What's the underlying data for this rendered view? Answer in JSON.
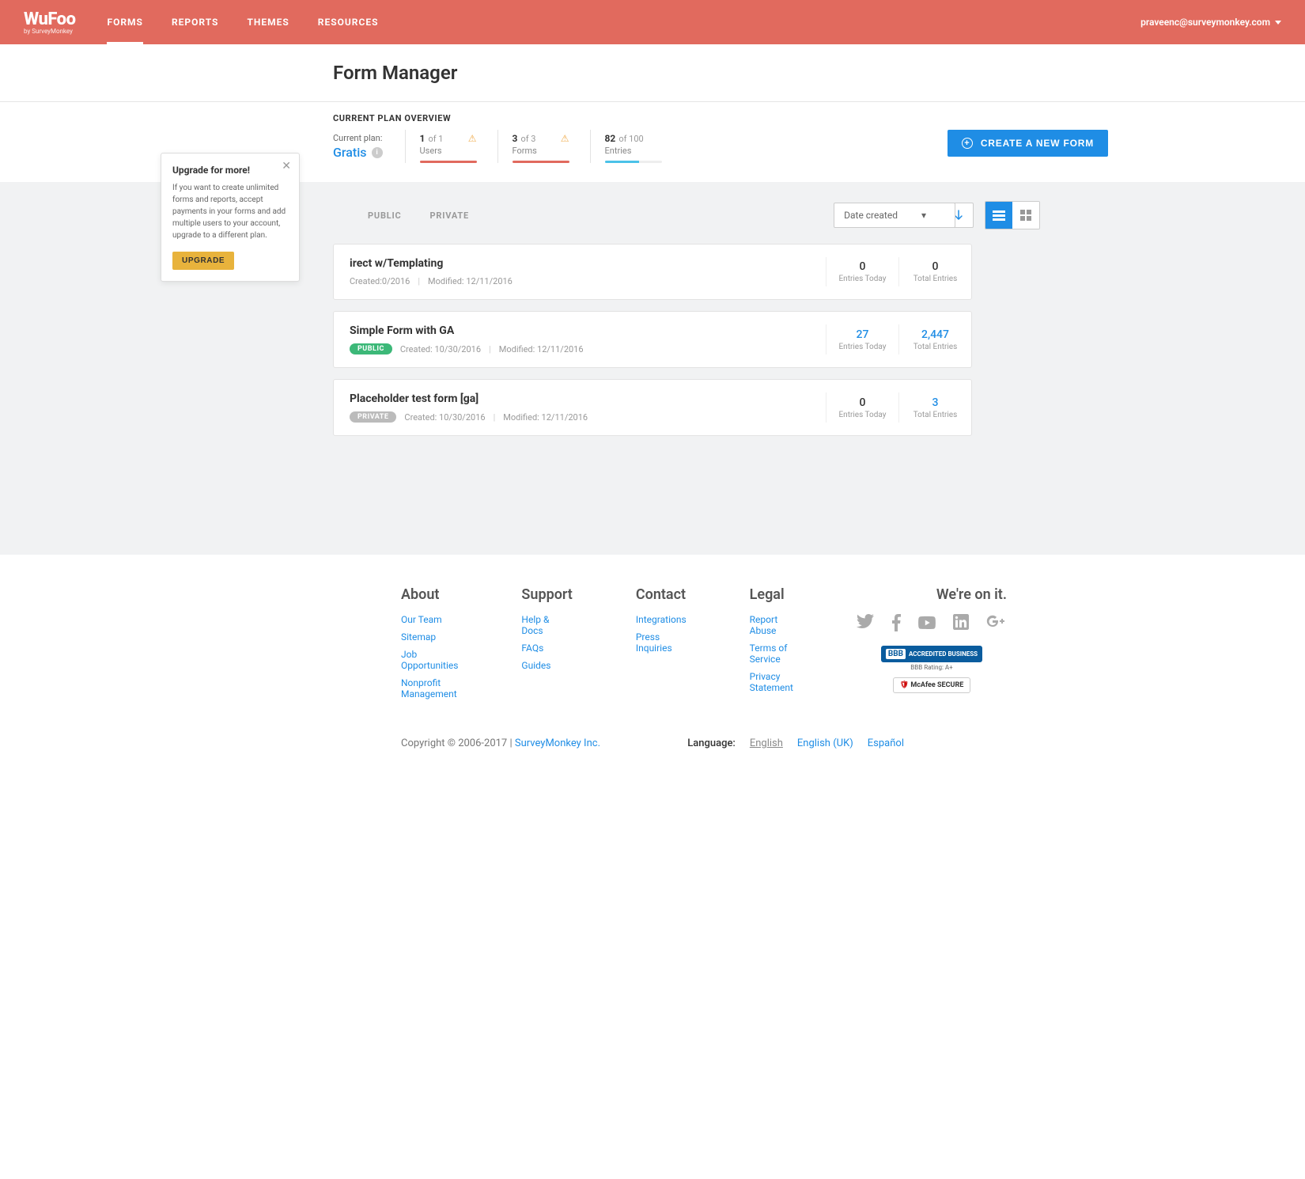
{
  "header": {
    "logo_main": "WuFoo",
    "logo_sub": "by SurveyMonkey",
    "nav": [
      "FORMS",
      "REPORTS",
      "THEMES",
      "RESOURCES"
    ],
    "active_nav": 0,
    "user_email": "praveenc@surveymonkey.com"
  },
  "page_title": "Form Manager",
  "overview": {
    "header": "CURRENT PLAN OVERVIEW",
    "plan_label": "Current plan:",
    "plan_name": "Gratis",
    "stats": [
      {
        "value": "1",
        "of": "of 1",
        "label": "Users",
        "fill_pct": 100,
        "color": "#e16a5e",
        "warn": true
      },
      {
        "value": "3",
        "of": "of 3",
        "label": "Forms",
        "fill_pct": 100,
        "color": "#e16a5e",
        "warn": true
      },
      {
        "value": "82",
        "of": "of 100",
        "label": "Entries",
        "fill_pct": 60,
        "color": "#4bc2e8",
        "warn": false
      }
    ],
    "create_btn": "CREATE A NEW FORM"
  },
  "popup": {
    "title": "Upgrade for more!",
    "body": "If you want to create unlimited forms and reports, accept payments in your forms and add multiple users to your account, upgrade to a different plan.",
    "button": "UPGRADE"
  },
  "toolbar": {
    "filters": [
      "PUBLIC",
      "PRIVATE"
    ],
    "sort_label": "Date created"
  },
  "forms": [
    {
      "title": "irect w/Templating",
      "visibility": "",
      "created": "Created:",
      "created_suffix": "0/2016",
      "modified": "Modified: 12/11/2016",
      "entries_today": "0",
      "total_entries": "0",
      "total_link": false
    },
    {
      "title": "Simple Form with GA",
      "visibility": "PUBLIC",
      "created": "Created: 10/30/2016",
      "created_suffix": "",
      "modified": "Modified: 12/11/2016",
      "entries_today": "27",
      "total_entries": "2,447",
      "total_link": true,
      "today_link": true
    },
    {
      "title": "Placeholder test form [ga]",
      "visibility": "PRIVATE",
      "created": "Created: 10/30/2016",
      "created_suffix": "",
      "modified": "Modified: 12/11/2016",
      "entries_today": "0",
      "total_entries": "3",
      "total_link": true
    }
  ],
  "stat_labels": {
    "today": "Entries Today",
    "total": "Total Entries"
  },
  "footer": {
    "cols": [
      {
        "title": "About",
        "links": [
          "Our Team",
          "Sitemap",
          "Job Opportunities",
          "Nonprofit Management"
        ]
      },
      {
        "title": "Support",
        "links": [
          "Help & Docs",
          "FAQs",
          "Guides"
        ]
      },
      {
        "title": "Contact",
        "links": [
          "Integrations",
          "Press Inquiries"
        ]
      },
      {
        "title": "Legal",
        "links": [
          "Report Abuse",
          "Terms of Service",
          "Privacy Statement"
        ]
      }
    ],
    "onit": "We're on it.",
    "bbb_text": "ACCREDITED BUSINESS",
    "bbb_rating": "BBB Rating: A+",
    "mcafee": "McAfee SECURE",
    "copyright": "Copyright © 2006-2017 | ",
    "company": "SurveyMonkey Inc.",
    "language_label": "Language:",
    "languages": [
      "English",
      "English (UK)",
      "Español"
    ],
    "current_lang": 0
  }
}
